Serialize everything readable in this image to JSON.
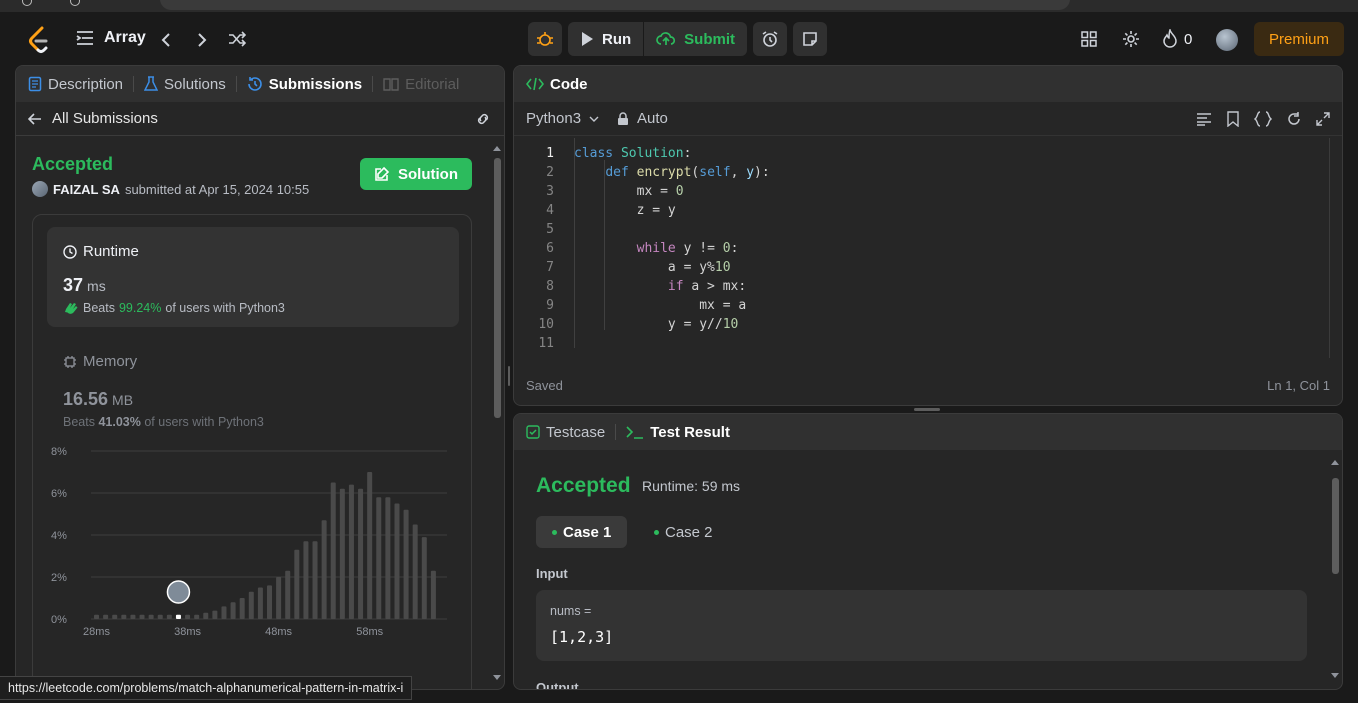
{
  "nav": {
    "problem_list": "Array",
    "run_label": "Run",
    "submit_label": "Submit",
    "streak_count": "0",
    "premium_label": "Premium"
  },
  "left_tabs": [
    {
      "label": "Description"
    },
    {
      "label": "Solutions"
    },
    {
      "label": "Submissions"
    },
    {
      "label": "Editorial"
    }
  ],
  "submission": {
    "back_label": "All Submissions",
    "status": "Accepted",
    "user": "FAIZAL SA",
    "submitted_text": "submitted at Apr 15, 2024 10:55",
    "solution_button": "Solution",
    "runtime": {
      "title": "Runtime",
      "value": "37",
      "unit": "ms",
      "beats_label": "Beats",
      "beats_pct": "99.24%",
      "beats_suffix": "of users with Python3"
    },
    "memory": {
      "title": "Memory",
      "value": "16.56",
      "unit": "MB",
      "beats_label": "Beats",
      "beats_pct": "41.03%",
      "beats_suffix": "of users with Python3"
    }
  },
  "chart_data": {
    "type": "bar",
    "y_ticks": [
      "8%",
      "6%",
      "4%",
      "2%",
      "0%"
    ],
    "x_ticks": [
      "28ms",
      "38ms",
      "48ms",
      "58ms"
    ],
    "ylim": [
      0,
      8
    ],
    "values": [
      0.2,
      0.2,
      0.2,
      0.2,
      0.2,
      0.2,
      0.2,
      0.2,
      0.2,
      0.2,
      0.2,
      0.2,
      0.3,
      0.4,
      0.6,
      0.8,
      1.0,
      1.3,
      1.5,
      1.6,
      2.0,
      2.3,
      3.3,
      3.7,
      3.7,
      4.7,
      6.5,
      6.2,
      6.4,
      6.2,
      7.0,
      5.8,
      5.8,
      5.5,
      5.2,
      4.5,
      3.9,
      2.3
    ],
    "highlight_index": 9,
    "bar_color": "#4a4a4a",
    "highlight_color": "#ffffff"
  },
  "code": {
    "header": "Code",
    "language": "Python3",
    "auto_label": "Auto",
    "saved_label": "Saved",
    "cursor_pos": "Ln 1, Col 1",
    "lines": [
      "class Solution:",
      "    def encrypt(self, y):",
      "        mx = 0",
      "        z = y",
      "",
      "        while y != 0:",
      "            a = y%10",
      "            if a > mx:",
      "                mx = a",
      "            y = y//10",
      ""
    ]
  },
  "test": {
    "testcase_tab": "Testcase",
    "result_tab": "Test Result",
    "status": "Accepted",
    "runtime": "Runtime: 59 ms",
    "cases": [
      "Case 1",
      "Case 2"
    ],
    "input_label": "Input",
    "var_name": "nums =",
    "var_value": "[1,2,3]",
    "output_label": "Output"
  },
  "status_url": "https://leetcode.com/problems/match-alphanumerical-pattern-in-matrix-i"
}
